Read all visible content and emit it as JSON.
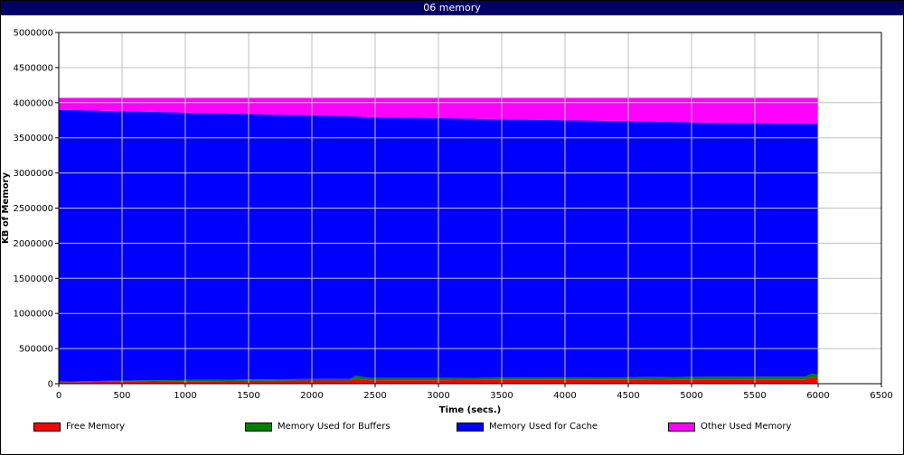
{
  "window": {
    "title": "06 memory"
  },
  "chart_data": {
    "type": "area",
    "stacked": true,
    "title": "06 memory",
    "xlabel": "Time (secs.)",
    "ylabel": "KB of Memory",
    "xlim": [
      0,
      6500
    ],
    "ylim": [
      0,
      5000000
    ],
    "xticks": [
      0,
      500,
      1000,
      1500,
      2000,
      2500,
      3000,
      3500,
      4000,
      4500,
      5000,
      5500,
      6000,
      6500
    ],
    "yticks": [
      0,
      500000,
      1000000,
      1500000,
      2000000,
      2500000,
      3000000,
      3500000,
      4000000,
      4500000,
      5000000
    ],
    "grid": true,
    "legend_position": "bottom",
    "x": [
      0,
      250,
      500,
      1000,
      1500,
      2000,
      2300,
      2350,
      2450,
      3000,
      3500,
      4000,
      4500,
      5000,
      5500,
      5900,
      5950,
      6000
    ],
    "series": [
      {
        "name": "Free Memory",
        "color": "#ff0000",
        "values": [
          20000,
          25000,
          30000,
          35000,
          40000,
          45000,
          45000,
          70000,
          50000,
          50000,
          55000,
          55000,
          55000,
          60000,
          60000,
          60000,
          90000,
          80000
        ]
      },
      {
        "name": "Memory Used for Buffers",
        "color": "#008000",
        "values": [
          10000,
          12000,
          15000,
          18000,
          20000,
          22000,
          22000,
          45000,
          30000,
          30000,
          32000,
          34000,
          36000,
          38000,
          40000,
          42000,
          55000,
          50000
        ]
      },
      {
        "name": "Memory Used for Cache",
        "color": "#0000ff",
        "values": [
          3870000,
          3853000,
          3835000,
          3807000,
          3780000,
          3753000,
          3743000,
          3690000,
          3715000,
          3700000,
          3678000,
          3661000,
          3649000,
          3622000,
          3610000,
          3598000,
          3555000,
          3570000
        ]
      },
      {
        "name": "Other Used Memory",
        "color": "#ff00ff",
        "values": [
          170000,
          180000,
          190000,
          210000,
          230000,
          250000,
          260000,
          265000,
          275000,
          290000,
          305000,
          320000,
          330000,
          350000,
          360000,
          370000,
          370000,
          370000
        ]
      }
    ]
  }
}
